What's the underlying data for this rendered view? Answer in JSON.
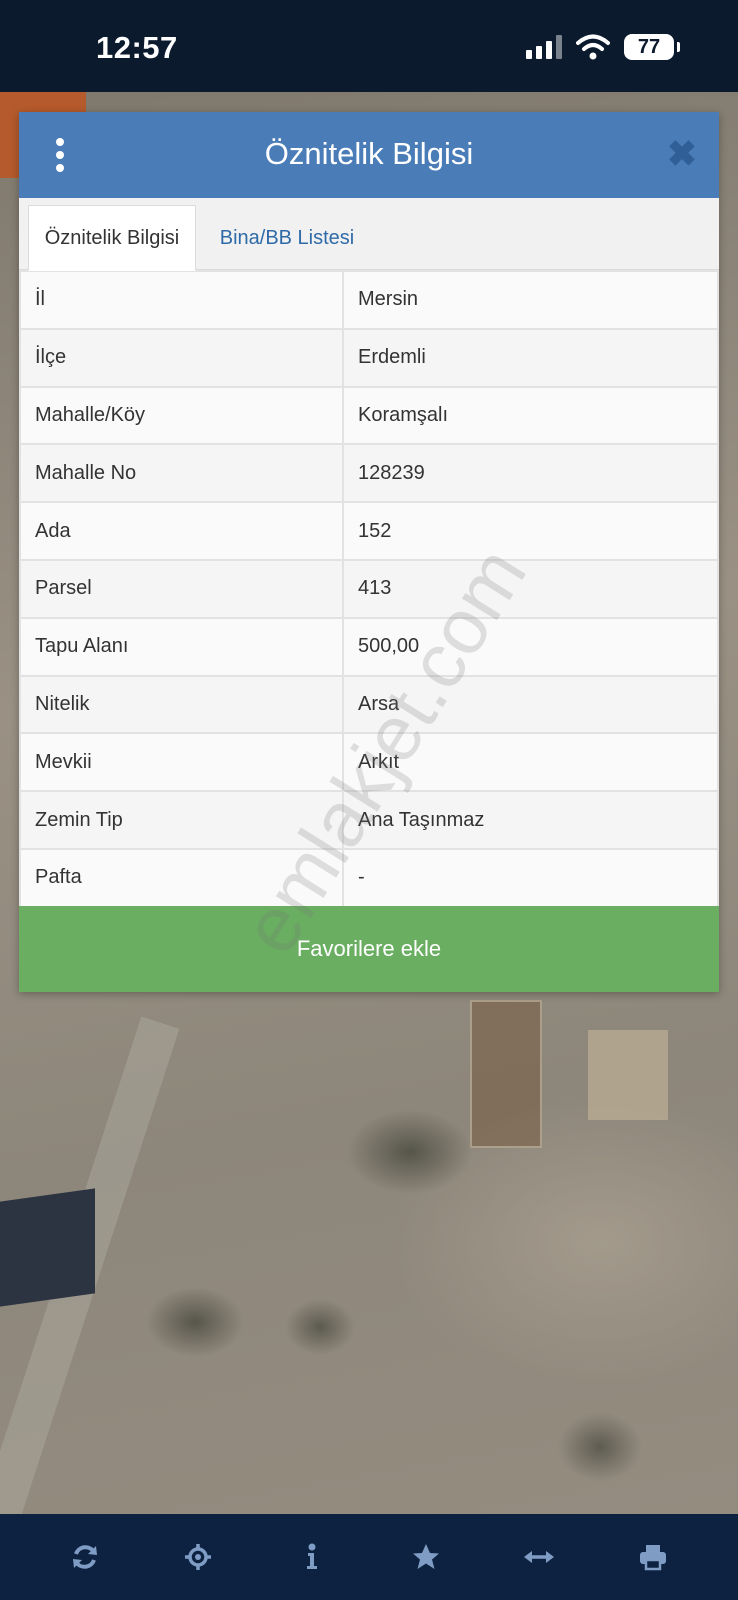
{
  "status_bar": {
    "time": "12:57",
    "battery": "77"
  },
  "dialog": {
    "title": "Öznitelik Bilgisi",
    "close_label": "✖",
    "tabs": [
      {
        "label": "Öznitelik Bilgisi",
        "active": true
      },
      {
        "label": "Bina/BB Listesi",
        "active": false
      }
    ],
    "rows": [
      {
        "key": "İl",
        "value": "Mersin"
      },
      {
        "key": "İlçe",
        "value": "Erdemli"
      },
      {
        "key": "Mahalle/Köy",
        "value": "Koramşalı"
      },
      {
        "key": "Mahalle No",
        "value": "128239"
      },
      {
        "key": "Ada",
        "value": "152"
      },
      {
        "key": "Parsel",
        "value": "413"
      },
      {
        "key": "Tapu Alanı",
        "value": "500,00"
      },
      {
        "key": "Nitelik",
        "value": "Arsa"
      },
      {
        "key": "Mevkii",
        "value": "Arkıt"
      },
      {
        "key": "Zemin Tip",
        "value": "Ana Taşınmaz"
      },
      {
        "key": "Pafta",
        "value": "-"
      }
    ],
    "favorite_button": "Favorilere ekle"
  },
  "watermark": "emlakjet.com",
  "toolbar": {
    "icons": [
      "refresh-icon",
      "locate-icon",
      "info-icon",
      "star-icon",
      "measure-icon",
      "print-icon"
    ]
  },
  "colors": {
    "header": "#4a7db8",
    "favorite": "#6aae62",
    "toolbar": "#0d2240",
    "status_bar": "#0c1a2e",
    "icon": "#7f9cc4"
  }
}
